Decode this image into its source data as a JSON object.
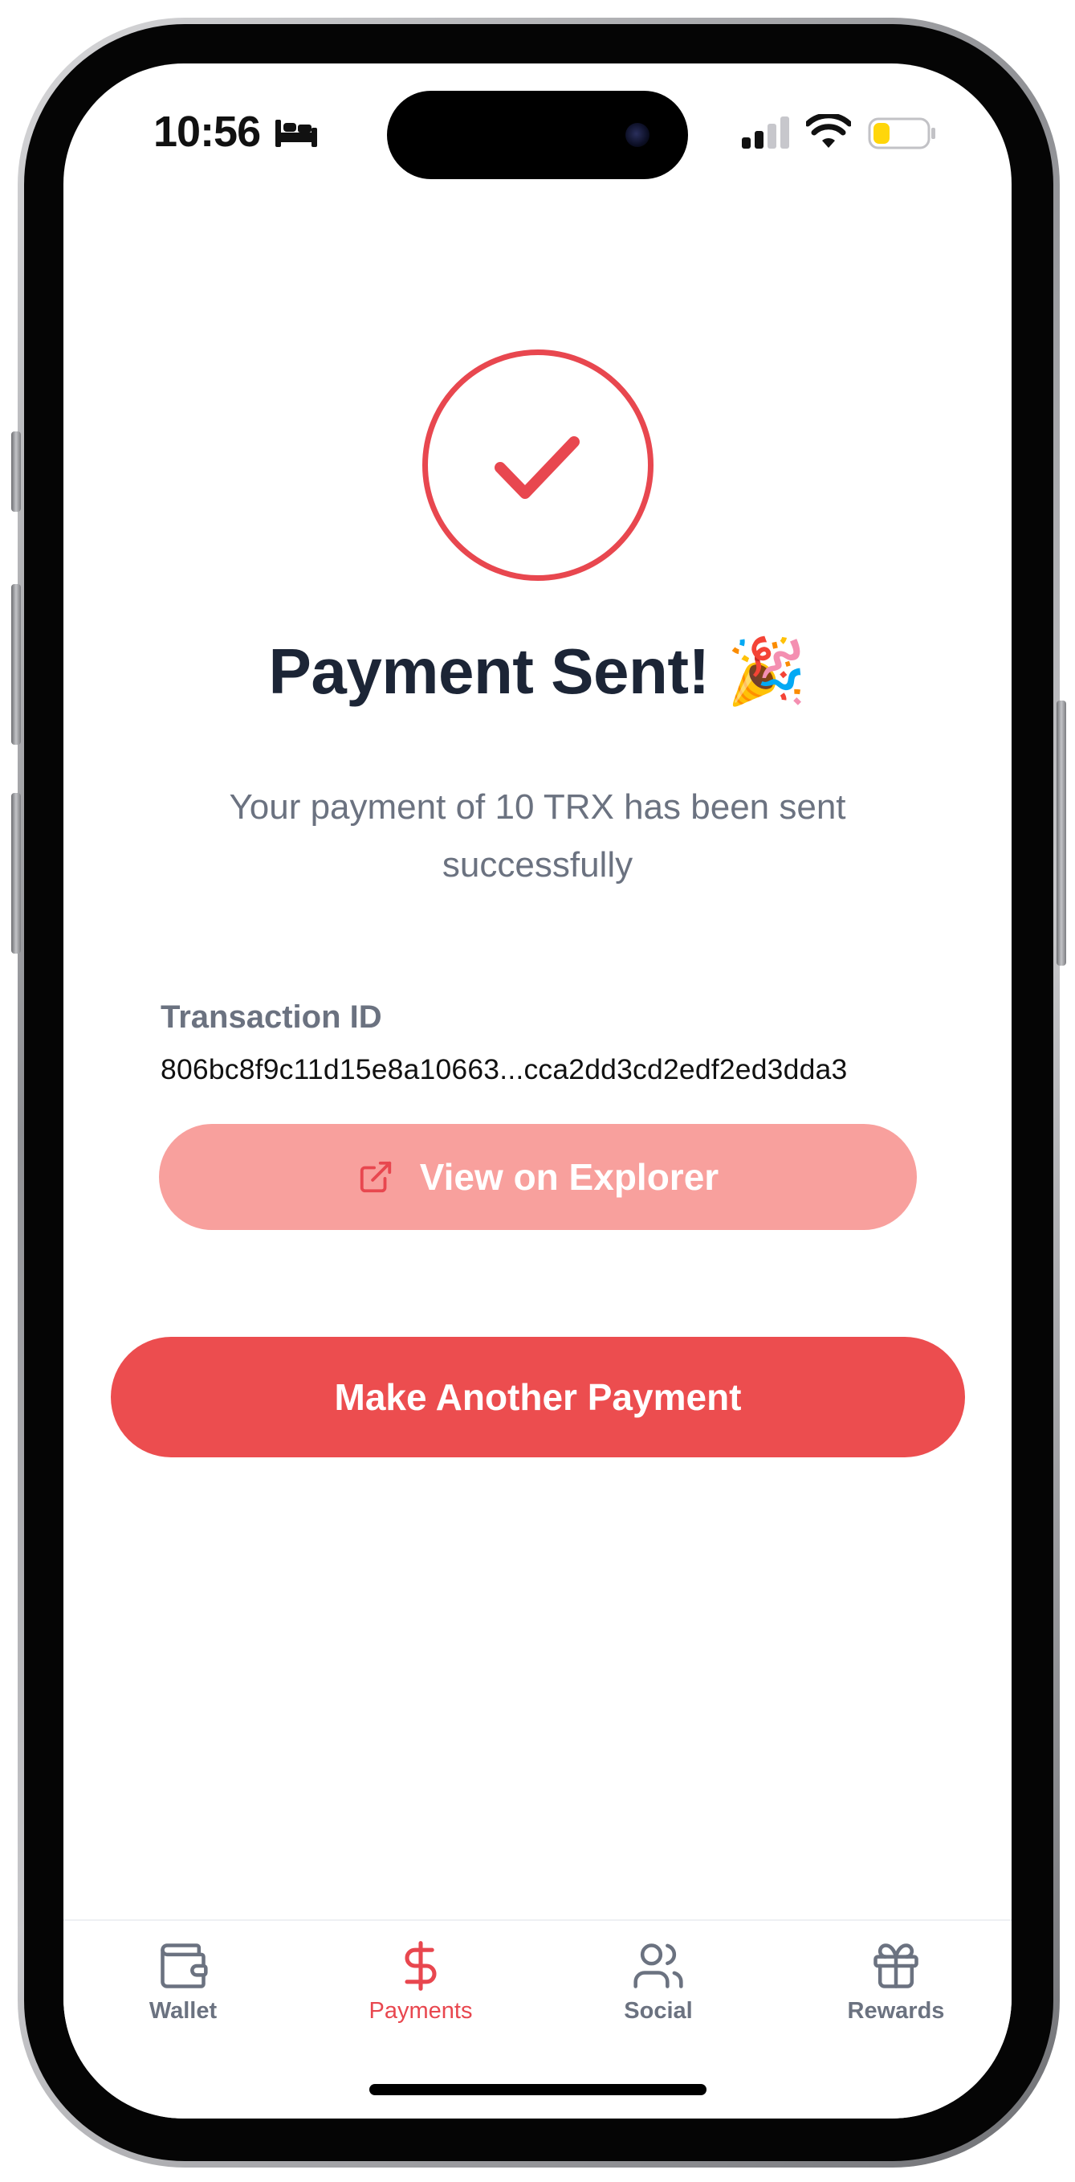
{
  "status_bar": {
    "time": "10:56",
    "icons": [
      "bed-icon",
      "signal-icon",
      "wifi-icon",
      "battery-icon"
    ]
  },
  "success": {
    "icon": "check-circle-icon",
    "title": "Payment Sent! 🎉",
    "message": "Your payment of 10 TRX has been sent successfully"
  },
  "transaction": {
    "label": "Transaction ID",
    "id": "806bc8f9c11d15e8a10663...cca2dd3cd2edf2ed3dda3"
  },
  "actions": {
    "explorer_label": "View on Explorer",
    "explorer_icon": "external-link-icon",
    "another_payment_label": "Make Another Payment"
  },
  "tabs": [
    {
      "label": "Wallet",
      "icon": "wallet-icon",
      "active": false
    },
    {
      "label": "Payments",
      "icon": "dollar-icon",
      "active": true
    },
    {
      "label": "Social",
      "icon": "users-icon",
      "active": false
    },
    {
      "label": "Rewards",
      "icon": "gift-icon",
      "active": false
    }
  ],
  "colors": {
    "accent": "#ec4d4f",
    "accent_light": "#f8a09d",
    "title_text": "#1c2536",
    "muted_text": "#6b7280"
  }
}
